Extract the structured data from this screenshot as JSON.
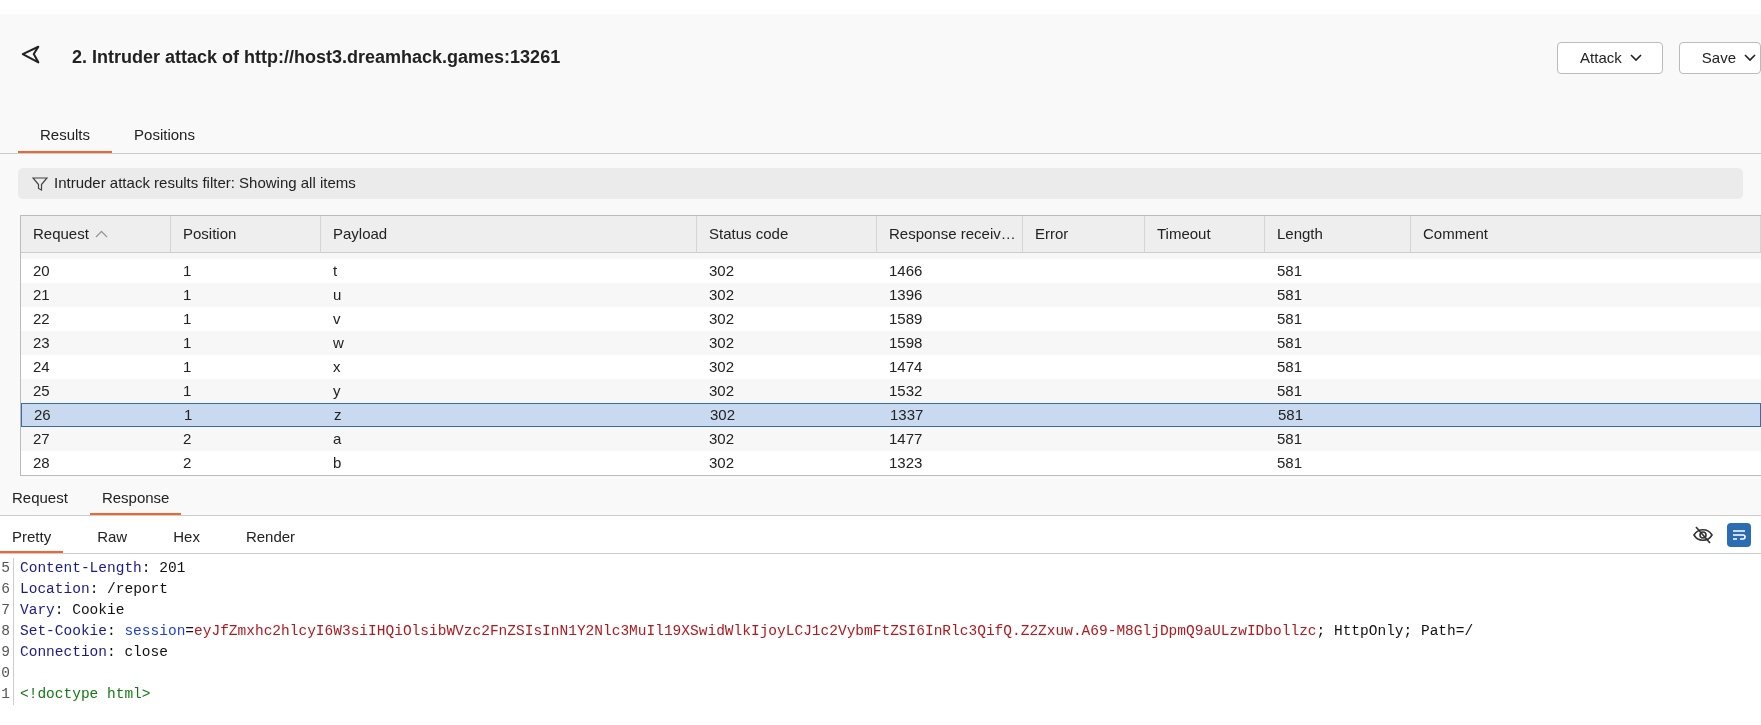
{
  "header": {
    "title": "2. Intruder attack of http://host3.dreamhack.games:13261",
    "buttons": [
      "Attack",
      "Save"
    ]
  },
  "tabs": [
    {
      "label": "Results",
      "selected": true
    },
    {
      "label": "Positions",
      "selected": false
    }
  ],
  "filter": {
    "text": "Intruder attack results filter: Showing all items"
  },
  "table": {
    "columns": [
      {
        "label": "Request",
        "sorted": true
      },
      {
        "label": "Position",
        "sorted": false
      },
      {
        "label": "Payload",
        "sorted": false
      },
      {
        "label": "Status code",
        "sorted": false
      },
      {
        "label": "Response receiv…",
        "sorted": false
      },
      {
        "label": "Error",
        "sorted": false
      },
      {
        "label": "Timeout",
        "sorted": false
      },
      {
        "label": "Length",
        "sorted": false
      },
      {
        "label": "Comment",
        "sorted": false
      }
    ],
    "rows": [
      {
        "cells": [
          "20",
          "1",
          "t",
          "302",
          "1466",
          "",
          "",
          "581",
          ""
        ],
        "selected": false
      },
      {
        "cells": [
          "21",
          "1",
          "u",
          "302",
          "1396",
          "",
          "",
          "581",
          ""
        ],
        "selected": false
      },
      {
        "cells": [
          "22",
          "1",
          "v",
          "302",
          "1589",
          "",
          "",
          "581",
          ""
        ],
        "selected": false
      },
      {
        "cells": [
          "23",
          "1",
          "w",
          "302",
          "1598",
          "",
          "",
          "581",
          ""
        ],
        "selected": false
      },
      {
        "cells": [
          "24",
          "1",
          "x",
          "302",
          "1474",
          "",
          "",
          "581",
          ""
        ],
        "selected": false
      },
      {
        "cells": [
          "25",
          "1",
          "y",
          "302",
          "1532",
          "",
          "",
          "581",
          ""
        ],
        "selected": false
      },
      {
        "cells": [
          "26",
          "1",
          "z",
          "302",
          "1337",
          "",
          "",
          "581",
          ""
        ],
        "selected": true
      },
      {
        "cells": [
          "27",
          "2",
          "a",
          "302",
          "1477",
          "",
          "",
          "581",
          ""
        ],
        "selected": false
      },
      {
        "cells": [
          "28",
          "2",
          "b",
          "302",
          "1323",
          "",
          "",
          "581",
          ""
        ],
        "selected": false
      }
    ]
  },
  "message_tabs": [
    {
      "label": "Request",
      "selected": false
    },
    {
      "label": "Response",
      "selected": true
    }
  ],
  "view_tabs": [
    {
      "label": "Pretty",
      "selected": true
    },
    {
      "label": "Raw",
      "selected": false
    },
    {
      "label": "Hex",
      "selected": false
    },
    {
      "label": "Render",
      "selected": false
    }
  ],
  "toolbar": {
    "wrap_on": true
  },
  "code_lines": [
    {
      "number": "5",
      "segments": [
        {
          "kind": "name",
          "text": "Content-Length"
        },
        {
          "kind": "plain",
          "text": ": 201"
        }
      ]
    },
    {
      "number": "6",
      "segments": [
        {
          "kind": "name",
          "text": "Location"
        },
        {
          "kind": "plain",
          "text": ": /report"
        }
      ]
    },
    {
      "number": "7",
      "segments": [
        {
          "kind": "name",
          "text": "Vary"
        },
        {
          "kind": "plain",
          "text": ": Cookie"
        }
      ]
    },
    {
      "number": "8",
      "segments": [
        {
          "kind": "name",
          "text": "Set-Cookie"
        },
        {
          "kind": "plain",
          "text": ": "
        },
        {
          "kind": "key",
          "text": "session"
        },
        {
          "kind": "plain",
          "text": "="
        },
        {
          "kind": "value",
          "text": "eyJfZmxhc2hlcyI6W3siIHQiOlsibWVzc2FnZSIsInN1Y2Nlc3MuIl19XSwidWlkIjoyLCJ1c2VybmFtZSI6InRlc3QifQ.Z2Zxuw.A69-M8GljDpmQ9aULzwIDbollzc"
        },
        {
          "kind": "plain",
          "text": "; HttpOnly; Path=/"
        }
      ]
    },
    {
      "number": "9",
      "segments": [
        {
          "kind": "name",
          "text": "Connection"
        },
        {
          "kind": "plain",
          "text": ": close"
        }
      ]
    },
    {
      "number": "0"
    },
    {
      "number": "1",
      "segments": [
        {
          "kind": "tag",
          "text": "<!doctype html>"
        }
      ]
    }
  ]
}
